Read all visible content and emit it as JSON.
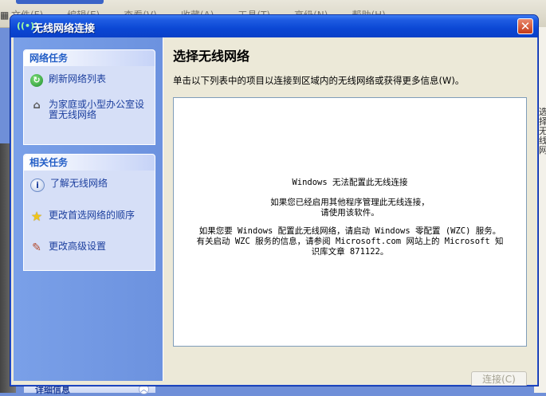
{
  "background_app": {
    "menu_items": [
      "文件(F)",
      "编辑(E)",
      "查看(V)",
      "收藏(A)",
      "工具(T)",
      "高级(N)",
      "帮助(H)"
    ],
    "side_text": "选择无线网",
    "bottom_panel_label": "详细信息"
  },
  "window": {
    "title": "无线网络连接",
    "close_glyph": "✕"
  },
  "network_tasks": {
    "header": "网络任务",
    "items": [
      {
        "label": "刷新网络列表",
        "icon": "refresh-icon"
      },
      {
        "label": "为家庭或小型办公室设置无线网络",
        "icon": "home-network-icon"
      }
    ]
  },
  "related_tasks": {
    "header": "相关任务",
    "items": [
      {
        "label": "了解无线网络",
        "icon": "info-icon"
      },
      {
        "label": "更改首选网络的顺序",
        "icon": "star-icon"
      },
      {
        "label": "更改高级设置",
        "icon": "wrench-icon"
      }
    ]
  },
  "main": {
    "title": "选择无线网络",
    "instruction": "单击以下列表中的项目以连接到区域内的无线网络或获得更多信息(W)。",
    "messages": {
      "line1": "Windows 无法配置此无线连接",
      "line2": "如果您已经启用其他程序管理此无线连接，",
      "line3": "请使用该软件。",
      "line4": "如果您要 Windows 配置此无线网络，请启动 Windows 零配置 (WZC) 服务。",
      "line5": "有关启动 WZC 服务的信息，请参阅 Microsoft.com 网站上的 Microsoft 知",
      "line6": "识库文章 871122。"
    },
    "connect_button": "连接(C)"
  }
}
